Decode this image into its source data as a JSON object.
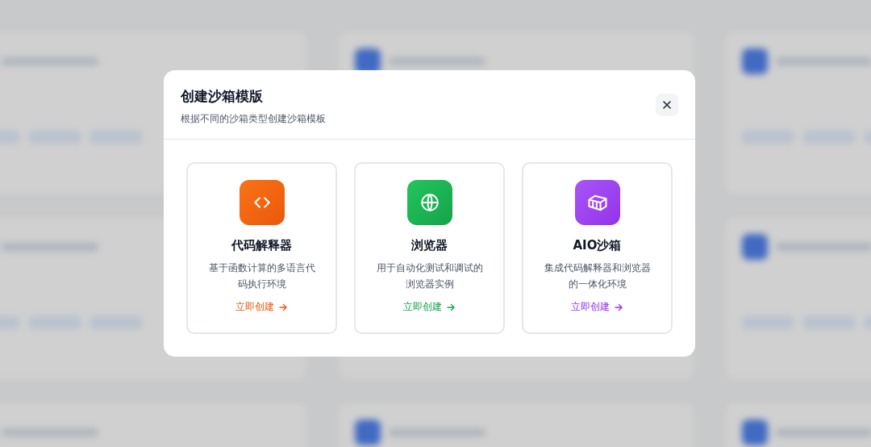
{
  "dialog": {
    "title": "创建沙箱模版",
    "subtitle": "根据不同的沙箱类型创建沙箱模板",
    "options": [
      {
        "kind": "code",
        "name": "代码解释器",
        "description": "基于函数计算的多语言代码执行环境",
        "action": "立即创建",
        "color": "#ea580c"
      },
      {
        "kind": "browser",
        "name": "浏览器",
        "description": "用于自动化测试和调试的浏览器实例",
        "action": "立即创建",
        "color": "#16a34a"
      },
      {
        "kind": "aio",
        "name": "AIO沙箱",
        "description": "集成代码解释器和浏览器的一体化环境",
        "action": "立即创建",
        "color": "#9333ea"
      }
    ]
  }
}
